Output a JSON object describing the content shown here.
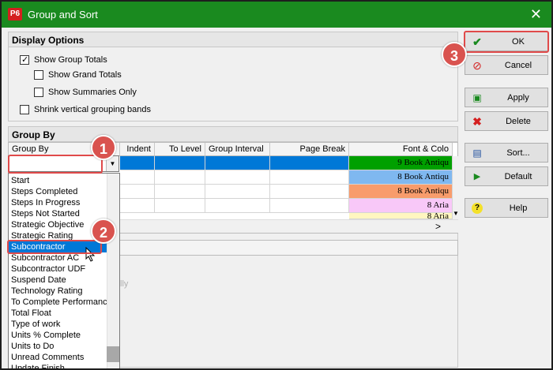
{
  "window": {
    "title": "Group and Sort",
    "app_icon": "P6",
    "close": "✕"
  },
  "display_options": {
    "header": "Display Options",
    "show_group_totals": {
      "label": "Show Group Totals",
      "checked": true
    },
    "show_grand_totals": {
      "label": "Show Grand Totals",
      "checked": false
    },
    "show_summaries_only": {
      "label": "Show Summaries Only",
      "checked": false
    },
    "shrink_bands": {
      "label": "Shrink vertical grouping bands",
      "checked": false
    }
  },
  "group_by": {
    "header": "Group By",
    "columns": [
      "Group By",
      "Indent",
      "To Level",
      "Group Interval",
      "Page Break",
      "Font & Colo"
    ],
    "rows": [
      {
        "font": "9 Book Antiqu",
        "color": "#00a000"
      },
      {
        "font": "8 Book Antiqu",
        "color": "#7fb8f0"
      },
      {
        "font": "8 Book Antiqu",
        "color": "#f89c6c"
      },
      {
        "font": "8 Aria",
        "color": "#f8c8f8"
      },
      {
        "font": "8 Aria",
        "color": "#fff6c0"
      }
    ],
    "combo_value": "",
    "dropdown_items": [
      "Start",
      "Steps Completed",
      "Steps In Progress",
      "Steps Not Started",
      "Strategic Objective",
      "Strategic Rating",
      "Subcontractor",
      "Subcontractor AC",
      "Subcontractor UDF",
      "Suspend Date",
      "Technology Rating",
      "To Complete Performance",
      "Total Float",
      "Type of work",
      "Units % Complete",
      "Units to Do",
      "Unread Comments",
      "Update Finish"
    ],
    "selected_item": "Subcontractor",
    "partial_text": "lly",
    "hscroll_arrow": ">"
  },
  "buttons": {
    "ok": "OK",
    "cancel": "Cancel",
    "apply": "Apply",
    "delete": "Delete",
    "sort": "Sort...",
    "default": "Default",
    "help": "Help"
  },
  "callouts": [
    "1",
    "2",
    "3"
  ],
  "colors": {
    "title_bar": "#1a8a1f",
    "selection": "#0078d7",
    "callout": "#d9534f"
  }
}
